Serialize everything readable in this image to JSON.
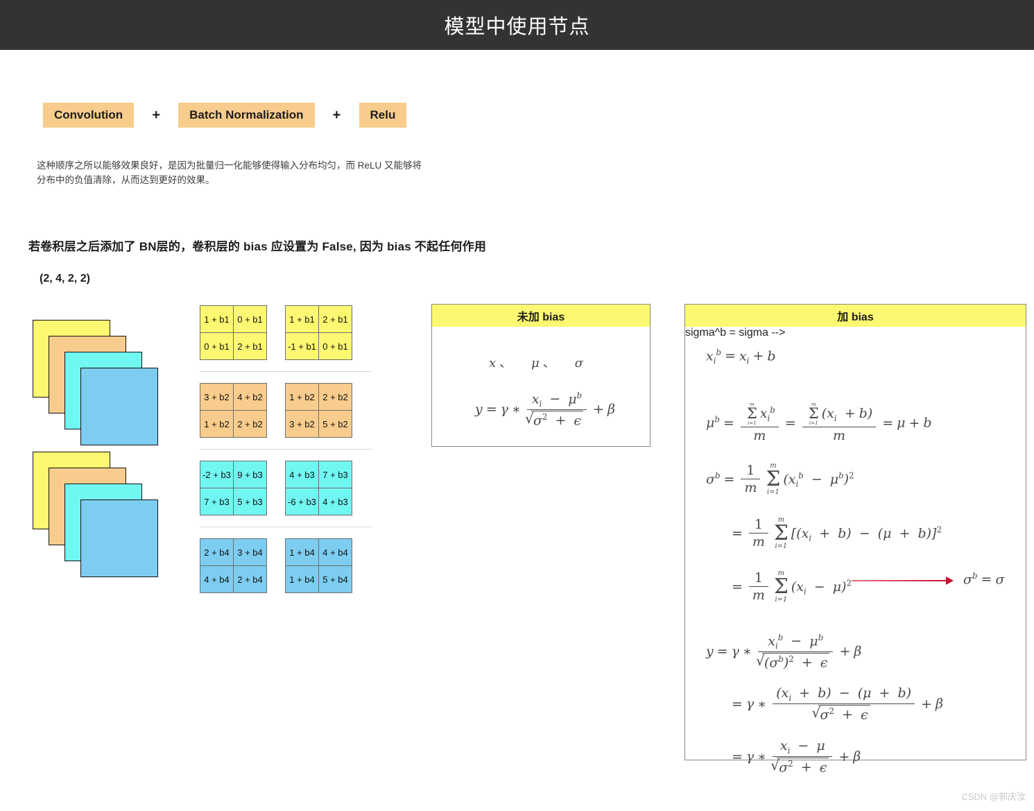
{
  "header": {
    "title": "模型中使用节点",
    "bg": "#333333",
    "fg": "#ffffff"
  },
  "pipeline": {
    "chip_color": "#f8cc8c",
    "items": [
      {
        "label": "Convolution"
      },
      {
        "label": "Batch Normalization"
      },
      {
        "label": "Relu"
      }
    ],
    "separator": "+"
  },
  "paragraph": {
    "line1": "这种顺序之所以能够效果良好，是因为批量归一化能够使得输入分布均匀，而 ReLU 又能够将",
    "line2": "分布中的负值清除，从而达到更好的效果。"
  },
  "statement": "若卷积层之后添加了 BN层的，卷积层的 bias 应设置为 False, 因为 bias 不起任何作用",
  "shape_note": "(2, 4, 2, 2)",
  "stacks": {
    "layer_colors": [
      "#fdf871",
      "#f8cc8c",
      "#71f7f2",
      "#7dcdf0"
    ],
    "count": 2
  },
  "matrices": [
    {
      "channel": "b1",
      "color": "#fdf871",
      "left": [
        [
          "1 + b1",
          "0 + b1"
        ],
        [
          "0 + b1",
          "2 + b1"
        ]
      ],
      "right": [
        [
          "1 + b1",
          "2 + b1"
        ],
        [
          "-1 + b1",
          "0 + b1"
        ]
      ]
    },
    {
      "channel": "b2",
      "color": "#f8cc8c",
      "left": [
        [
          "3 + b2",
          "4 + b2"
        ],
        [
          "1 + b2",
          "2 + b2"
        ]
      ],
      "right": [
        [
          "1 + b2",
          "2 + b2"
        ],
        [
          "3 + b2",
          "5 + b2"
        ]
      ]
    },
    {
      "channel": "b3",
      "color": "#71f7f2",
      "left": [
        [
          "-2 + b3",
          "9 + b3"
        ],
        [
          "7 + b3",
          "5 + b3"
        ]
      ],
      "right": [
        [
          "4 + b3",
          "7 + b3"
        ],
        [
          "-6 + b3",
          "4 + b3"
        ]
      ]
    },
    {
      "channel": "b4",
      "color": "#7dcdf0",
      "left": [
        [
          "2 + b4",
          "3 + b4"
        ],
        [
          "4 + b4",
          "2 + b4"
        ]
      ],
      "right": [
        [
          "1 + b4",
          "4 + b4"
        ],
        [
          "1 + b4",
          "5 + b4"
        ]
      ]
    }
  ],
  "panel_nobias": {
    "title": "未加 bias",
    "header_color": "#fdf871",
    "symbols_line": "x、  μ、  σ",
    "formula": "y = γ * (x_i − μ^b) / sqrt(σ² + ε) + β"
  },
  "panel_bias": {
    "title": "加 bias",
    "header_color": "#fdf871",
    "formulas": [
      "x_i^b = x_i + b",
      "μ^b = Σ_{i=1}^{m} x_i^b / m = Σ_{i=1}^{m} (x_i + b) / m = μ + b",
      "σ^b = (1/m) Σ_{i=1}^{m} (x_i^b − μ^b)²",
      "= (1/m) Σ_{i=1}^{m} [(x_i + b) − (μ + b)]²",
      "= (1/m) Σ_{i=1}^{m} (x_i − μ)²",
      "y = γ * (x_i^b − μ^b) / sqrt((σ^b)² + ε) + β",
      "= γ * ((x_i + b) − (μ + b)) / sqrt(σ² + ε) + β",
      "= γ * (x_i − μ) / sqrt(σ² + ε) + β"
    ],
    "arrow_conclusion": "σ^b = σ",
    "arrow_color": "#c8102e"
  },
  "watermark": "CSDN @郭庆汝"
}
